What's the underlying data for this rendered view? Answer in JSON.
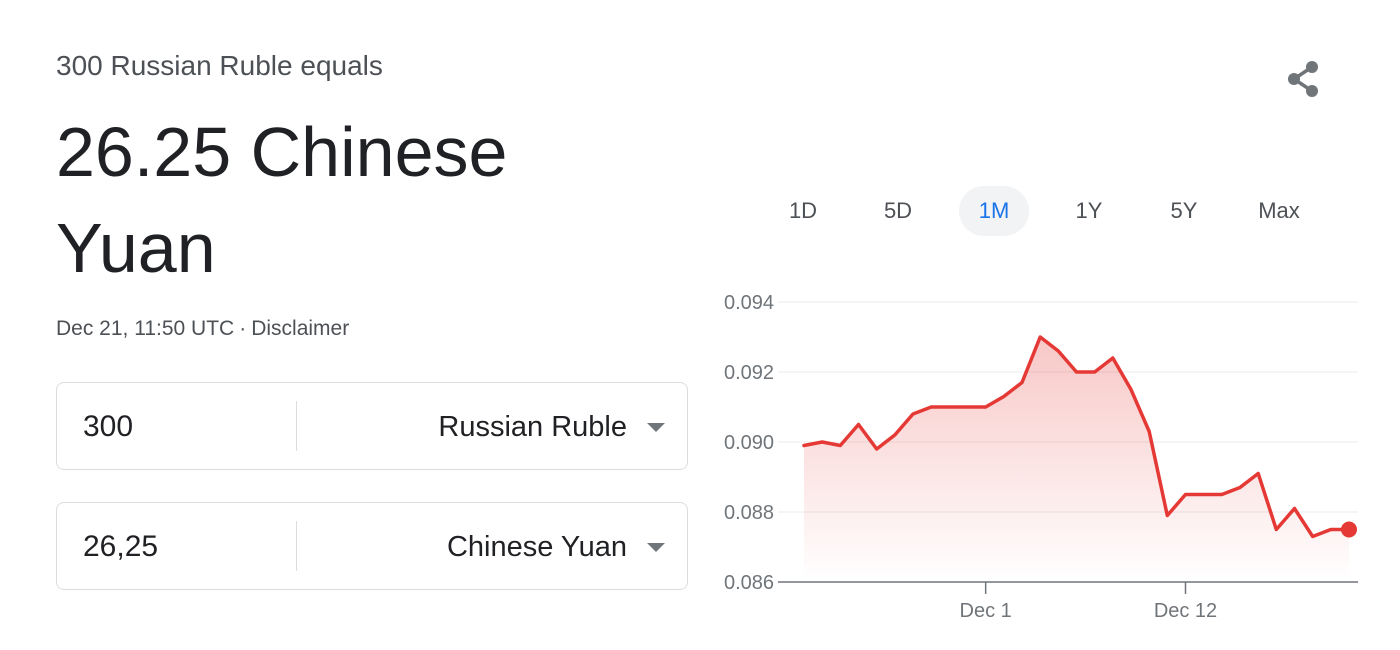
{
  "header": {
    "equals_text": "300 Russian Ruble equals",
    "result_text": "26.25 Chinese Yuan",
    "timestamp": "Dec 21, 11:50 UTC",
    "separator": "·",
    "disclaimer": "Disclaimer"
  },
  "converter": {
    "from": {
      "value": "300",
      "currency": "Russian Ruble"
    },
    "to": {
      "value": "26,25",
      "currency": "Chinese Yuan"
    }
  },
  "share": {
    "icon": "share-icon"
  },
  "ranges": {
    "items": [
      {
        "label": "1D",
        "active": false
      },
      {
        "label": "5D",
        "active": false
      },
      {
        "label": "1M",
        "active": true
      },
      {
        "label": "1Y",
        "active": false
      },
      {
        "label": "5Y",
        "active": false
      },
      {
        "label": "Max",
        "active": false
      }
    ]
  },
  "colors": {
    "line": "#e53935",
    "active_tab": "#1a73e8",
    "grid": "#ebebeb",
    "axis": "#70757a"
  },
  "chart_data": {
    "type": "area",
    "title": "",
    "xlabel": "",
    "ylabel": "",
    "ylim": [
      0.086,
      0.094
    ],
    "y_ticks": [
      "0.094",
      "0.092",
      "0.090",
      "0.088",
      "0.086"
    ],
    "x_tick_labels": [
      {
        "label": "Dec 1",
        "index": 10
      },
      {
        "label": "Dec 12",
        "index": 21
      }
    ],
    "grid": true,
    "series": [
      {
        "values": [
          0.0899,
          0.09,
          0.0899,
          0.0905,
          0.0898,
          0.0902,
          0.0908,
          0.091,
          0.091,
          0.091,
          0.091,
          0.0913,
          0.0917,
          0.093,
          0.0926,
          0.092,
          0.092,
          0.0924,
          0.0915,
          0.0903,
          0.0879,
          0.0885,
          0.0885,
          0.0885,
          0.0887,
          0.0891,
          0.0875,
          0.0881,
          0.0873,
          0.0875,
          0.0875
        ]
      }
    ]
  }
}
